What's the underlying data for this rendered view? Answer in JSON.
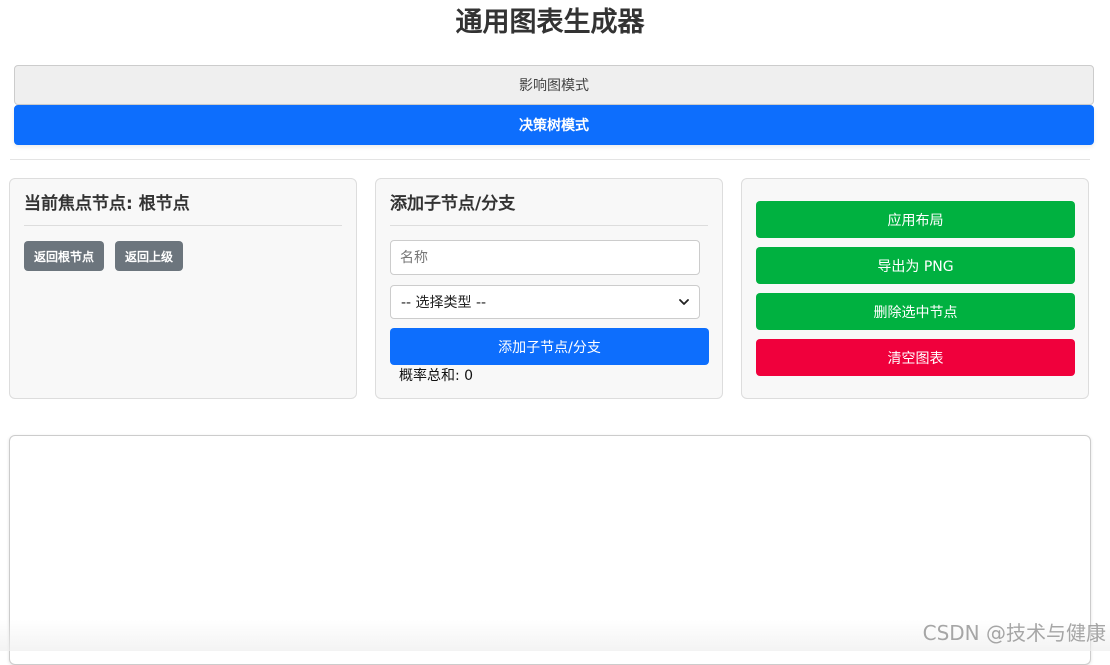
{
  "header": {
    "title": "通用图表生成器"
  },
  "modes": {
    "influence_label": "影响图模式",
    "decision_label": "决策树模式"
  },
  "focus_panel": {
    "heading": "当前焦点节点: 根节点",
    "back_root_label": "返回根节点",
    "back_up_label": "返回上级"
  },
  "add_panel": {
    "heading": "添加子节点/分支",
    "name_placeholder": "名称",
    "type_selected": "-- 选择类型 --",
    "add_button_label": "添加子节点/分支",
    "probability_sum": "概率总和: 0"
  },
  "actions_panel": {
    "apply_layout_label": "应用布局",
    "export_png_label": "导出为 PNG",
    "delete_selected_label": "删除选中节点",
    "clear_chart_label": "清空图表"
  },
  "watermark": "CSDN @技术与健康",
  "colors": {
    "primary": "#0d6efd",
    "success": "#00b140",
    "danger": "#f0003c",
    "secondary": "#6c757d"
  }
}
